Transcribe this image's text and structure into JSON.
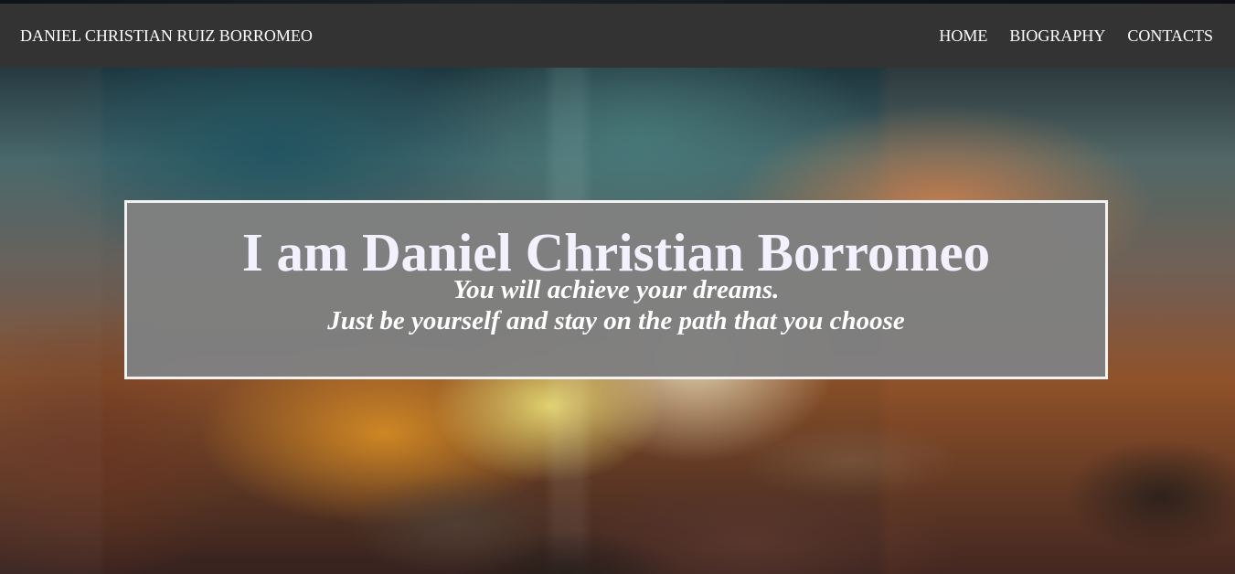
{
  "header": {
    "brand": "DANIEL CHRISTIAN RUIZ BORROMEO",
    "nav": [
      {
        "label": "HOME"
      },
      {
        "label": "BIOGRAPHY"
      },
      {
        "label": "CONTACTS"
      }
    ]
  },
  "hero": {
    "title": "I am Daniel Christian Borromeo",
    "lines": [
      "You will achieve your dreams.",
      "Just be yourself and stay on the path that you choose"
    ]
  },
  "colors": {
    "navbar": "#333333",
    "box_fill": "#808080",
    "box_border": "#f2f2f2",
    "text": "#ffffff"
  }
}
